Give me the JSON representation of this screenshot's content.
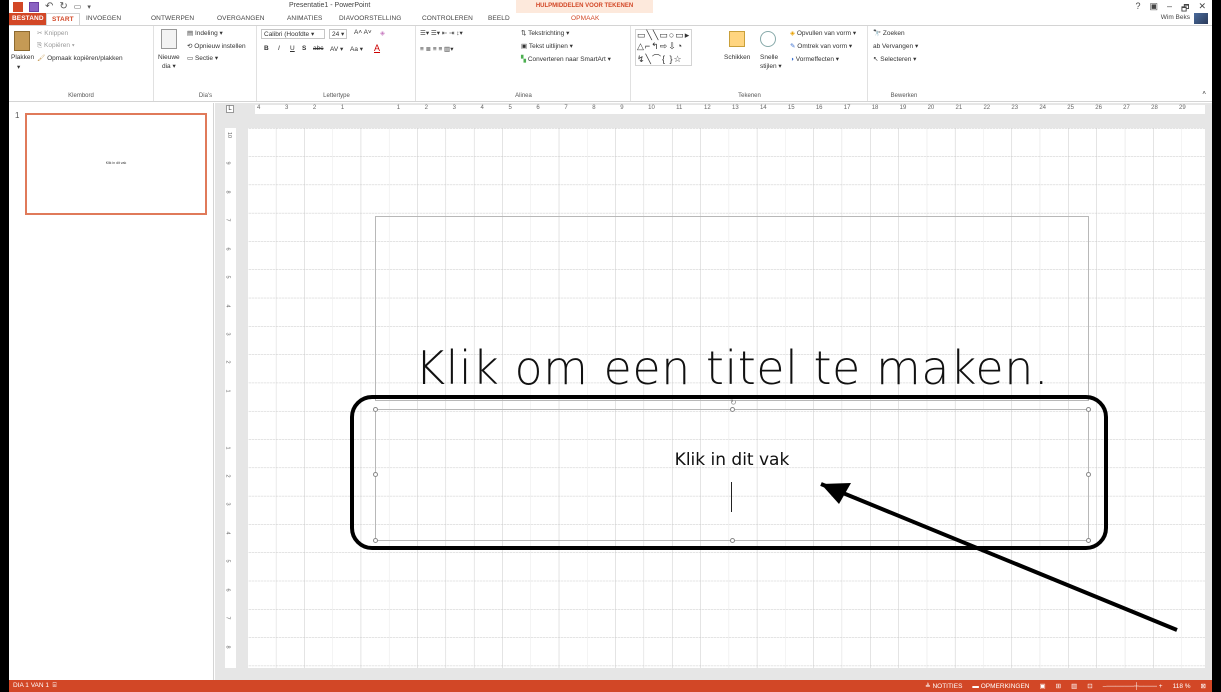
{
  "window": {
    "title": "Presentatie1 - PowerPoint",
    "contextual_group": "HULPMIDDELEN VOOR TEKENEN",
    "controls": [
      "?",
      "▣",
      "–",
      "🗗",
      "✕"
    ],
    "user": "Wim Beks"
  },
  "tabs": [
    {
      "label": "BESTAND"
    },
    {
      "label": "START"
    },
    {
      "label": "INVOEGEN"
    },
    {
      "label": "ONTWERPEN"
    },
    {
      "label": "OVERGANGEN"
    },
    {
      "label": "ANIMATIES"
    },
    {
      "label": "DIAVOORSTELLING"
    },
    {
      "label": "CONTROLEREN"
    },
    {
      "label": "BEELD"
    },
    {
      "label": "OPMAAK"
    }
  ],
  "ribbon": {
    "klembord": {
      "paste": "Plakken",
      "cut": "Knippen",
      "copy": "Kopiëren",
      "format_painter": "Opmaak kopiëren/plakken",
      "label": "Klembord"
    },
    "dias": {
      "new_slide_1": "Nieuwe",
      "new_slide_2": "dia",
      "layout": "Indeling",
      "reset": "Opnieuw instellen",
      "section": "Sectie",
      "label": "Dia's"
    },
    "lettertype": {
      "font": "Calibri (Hoofdte",
      "size": "24",
      "label": "Lettertype",
      "bold": "B",
      "italic": "I",
      "underline": "U",
      "shadow": "S",
      "strike": "abc",
      "case": "Aa"
    },
    "alinea": {
      "text_direction": "Tekstrichting",
      "align_text": "Tekst uitlijnen",
      "smartart": "Converteren naar SmartArt",
      "label": "Alinea"
    },
    "tekenen": {
      "arrange": "Schikken",
      "quick_styles_1": "Snelle",
      "quick_styles_2": "stijlen",
      "fill": "Opvullen van vorm",
      "outline": "Omtrek van vorm",
      "effects": "Vormeffecten",
      "label": "Tekenen"
    },
    "bewerken": {
      "find": "Zoeken",
      "replace": "Vervangen",
      "select": "Selecteren",
      "label": "Bewerken"
    }
  },
  "ruler": {
    "h_ticks": [
      "4",
      "3",
      "2",
      "1",
      "",
      "1",
      "2",
      "3",
      "4",
      "5",
      "6",
      "7",
      "8",
      "9",
      "10",
      "11",
      "12",
      "13",
      "14",
      "15",
      "16",
      "17",
      "18",
      "19",
      "20",
      "21",
      "22",
      "23",
      "24",
      "25",
      "26",
      "27",
      "28",
      "29"
    ],
    "v_ticks": [
      "10",
      "9",
      "8",
      "7",
      "6",
      "5",
      "4",
      "3",
      "2",
      "1",
      "",
      "1",
      "2",
      "3",
      "4",
      "5",
      "6",
      "7",
      "8"
    ]
  },
  "thumbnail": {
    "number": "1",
    "text": "Klik in dit vak"
  },
  "slide": {
    "title": "Klik om een titel te maken.",
    "subtitle": "Klik in dit vak"
  },
  "status": {
    "slide_info": "DIA 1 VAN 1",
    "notes": "NOTITIES",
    "comments": "OPMERKINGEN",
    "zoom": "118 %"
  },
  "colors": {
    "accent": "#d24726",
    "contextual_bg": "#fde9dc",
    "thumb_border": "#e07a5a"
  }
}
